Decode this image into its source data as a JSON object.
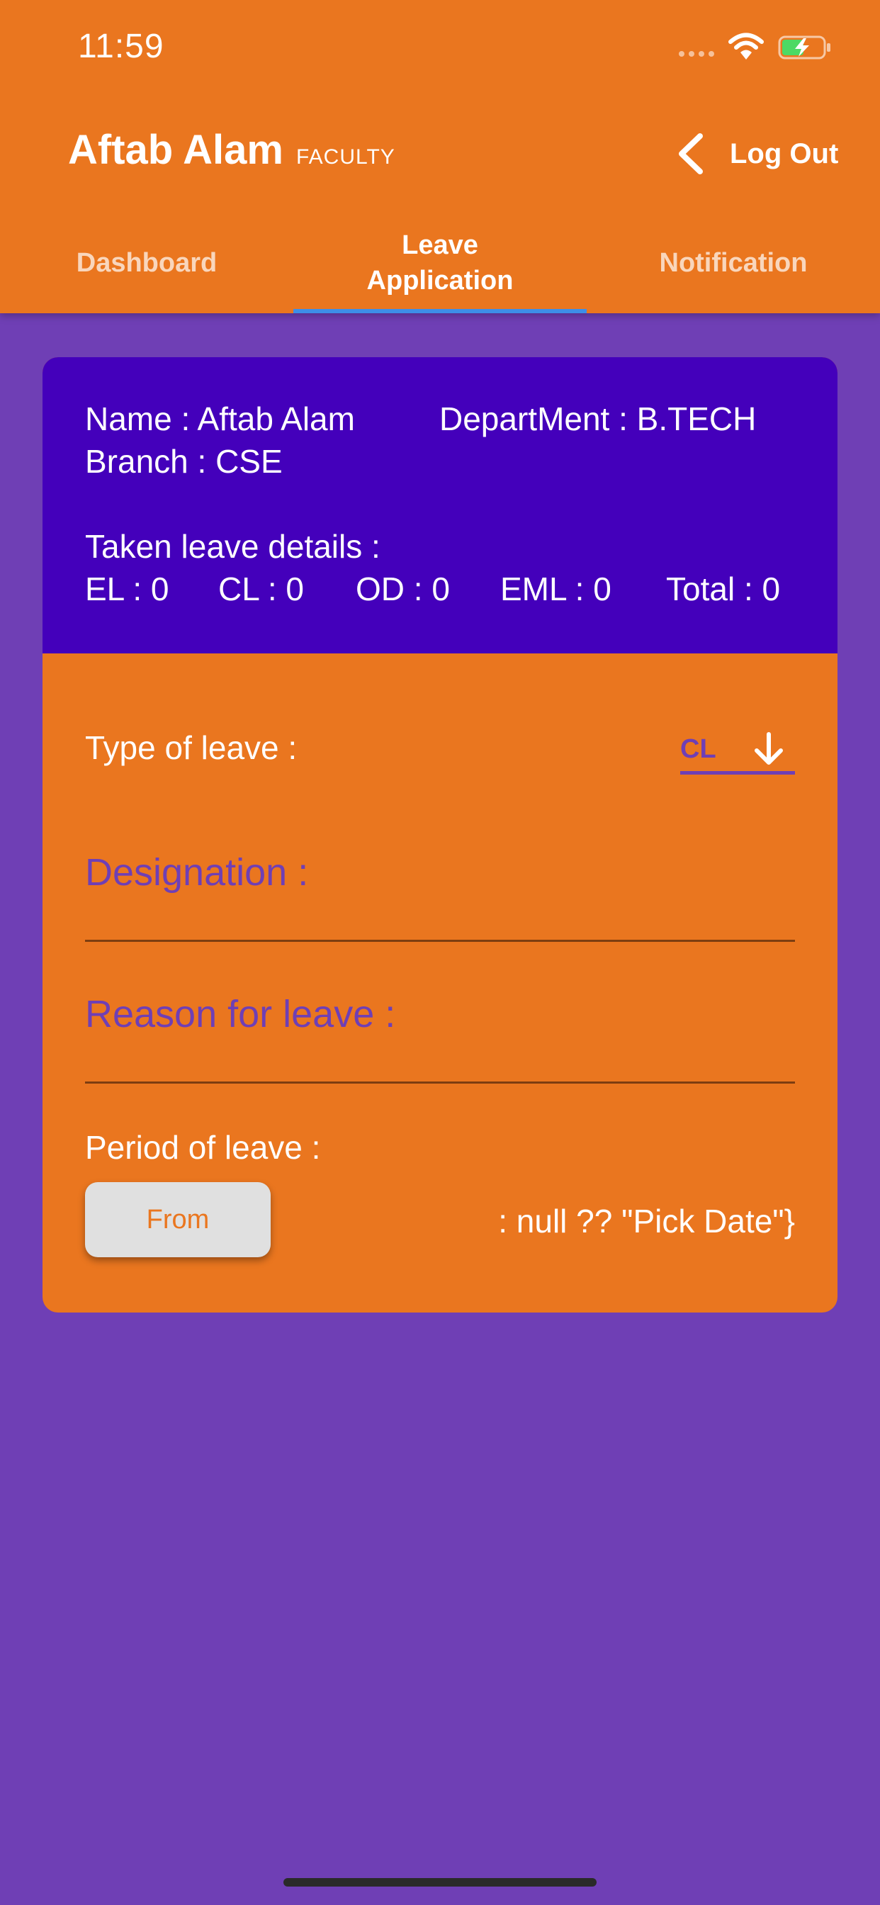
{
  "status_bar": {
    "time": "11:59"
  },
  "header": {
    "title": "Aftab Alam",
    "role": "FACULTY",
    "logout_label": "Log Out"
  },
  "tabs": [
    {
      "label": "Dashboard",
      "active": false
    },
    {
      "label": "Leave\nApplication",
      "active": true
    },
    {
      "label": "Notification",
      "active": false
    }
  ],
  "profile": {
    "name": "Name : Aftab Alam",
    "department": "DepartMent : B.TECH",
    "branch": "Branch : CSE",
    "leave_details_title": "Taken leave details :",
    "el": "EL : 0",
    "cl": "CL : 0",
    "od": "OD : 0",
    "eml": "EML : 0",
    "total": "Total : 0"
  },
  "form": {
    "type_label": "Type of leave :",
    "type_value": "CL",
    "designation_placeholder": "Designation :",
    "reason_placeholder": "Reason for leave :",
    "period_label": "Period of leave :",
    "from_button": "From",
    "pick_date_text": ": null ?? \"Pick Date\"}"
  },
  "colors": {
    "primary": "#ea761f",
    "background": "#6f3fb5",
    "card_header": "#4400bb",
    "tab_indicator": "#3d8ee8"
  }
}
